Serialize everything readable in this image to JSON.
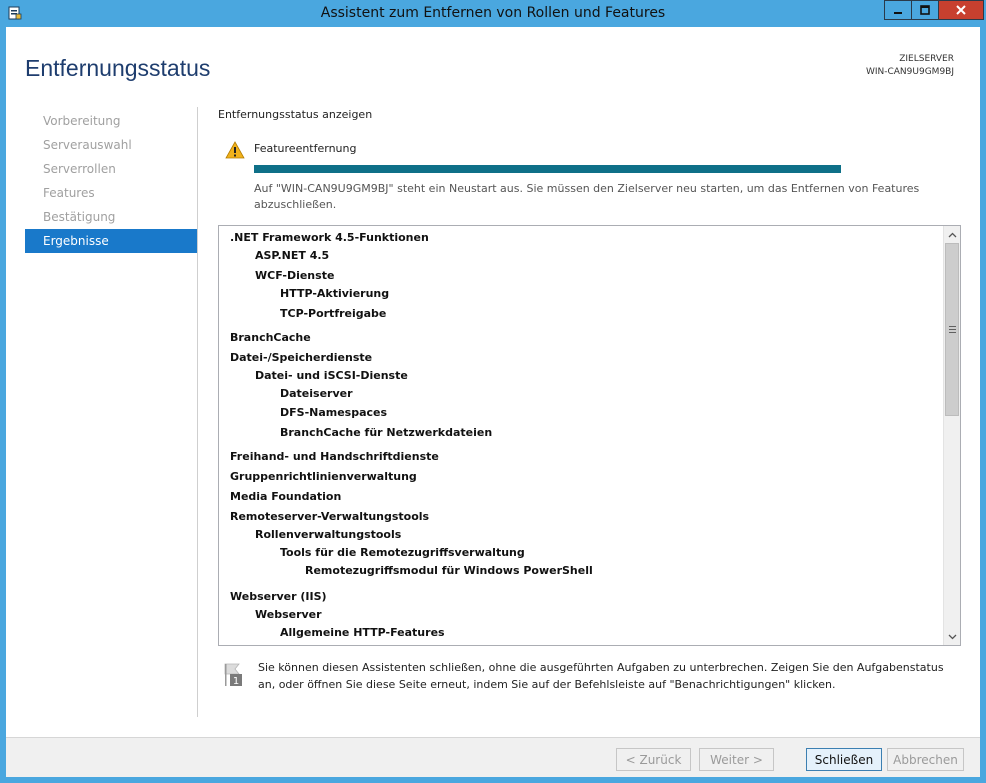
{
  "window": {
    "title": "Assistent zum Entfernen von Rollen und Features",
    "accent": "#4aa7df",
    "close_color": "#c7402f"
  },
  "page": {
    "title": "Entfernungsstatus",
    "target_server_label": "ZIELSERVER",
    "target_server_name": "WIN-CAN9U9GM9BJ"
  },
  "nav": {
    "items": [
      {
        "label": "Vorbereitung",
        "state": "disabled"
      },
      {
        "label": "Serverauswahl",
        "state": "disabled"
      },
      {
        "label": "Serverrollen",
        "state": "disabled"
      },
      {
        "label": "Features",
        "state": "disabled"
      },
      {
        "label": "Bestätigung",
        "state": "disabled"
      },
      {
        "label": "Ergebnisse",
        "state": "active"
      }
    ],
    "active_color": "#1979ca"
  },
  "status": {
    "header": "Entfernungsstatus anzeigen",
    "icon": "warning-icon",
    "feature_label": "Featureentfernung",
    "progress_fraction": 1.0,
    "progress_color": "#0e7088",
    "message": "Auf \"WIN-CAN9U9GM9BJ\" steht ein Neustart aus. Sie müssen den Zielserver neu starten, um das Entfernen von Features abzuschließen."
  },
  "feature_list": [
    {
      "text": ".NET Framework 4.5-Funktionen",
      "level": 0
    },
    {
      "text": "ASP.NET 4.5",
      "level": 1
    },
    {
      "text": "WCF-Dienste",
      "level": 1
    },
    {
      "text": "HTTP-Aktivierung",
      "level": 2
    },
    {
      "text": "TCP-Portfreigabe",
      "level": 2
    },
    {
      "text": "BranchCache",
      "level": 0
    },
    {
      "text": "Datei-/Speicherdienste",
      "level": 0
    },
    {
      "text": "Datei- und iSCSI-Dienste",
      "level": 1
    },
    {
      "text": "Dateiserver",
      "level": 2
    },
    {
      "text": "DFS-Namespaces",
      "level": 2
    },
    {
      "text": "BranchCache für Netzwerkdateien",
      "level": 2
    },
    {
      "text": "Freihand- und Handschriftdienste",
      "level": 0
    },
    {
      "text": "Gruppenrichtlinienverwaltung",
      "level": 0
    },
    {
      "text": "Media Foundation",
      "level": 0
    },
    {
      "text": "Remoteserver-Verwaltungstools",
      "level": 0
    },
    {
      "text": "Rollenverwaltungstools",
      "level": 1
    },
    {
      "text": "Tools für die Remotezugriffsverwaltung",
      "level": 2
    },
    {
      "text": "Remotezugriffsmodul für Windows PowerShell",
      "level": 3
    },
    {
      "text": "Webserver (IIS)",
      "level": 0
    },
    {
      "text": "Webserver",
      "level": 1
    },
    {
      "text": "Allgemeine HTTP-Features",
      "level": 2
    }
  ],
  "info": {
    "icon": "notification-flag-icon",
    "badge": "1",
    "text": "Sie können diesen Assistenten schließen, ohne die ausgeführten Aufgaben zu unterbrechen. Zeigen Sie den Aufgabenstatus an, oder öffnen Sie diese Seite erneut, indem Sie auf der Befehlsleiste auf \"Benachrichtigungen\" klicken."
  },
  "buttons": {
    "back": "< Zurück",
    "next": "Weiter >",
    "close": "Schließen",
    "cancel": "Abbrechen"
  }
}
